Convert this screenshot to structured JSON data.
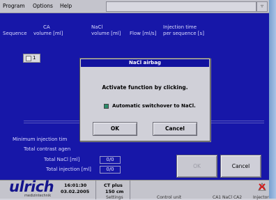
{
  "menu": {
    "items": [
      "Program",
      "Options",
      "Help"
    ]
  },
  "table": {
    "headers": {
      "sequence": "Sequence",
      "ca_top": "CA",
      "ca_bottom": "volume [ml]",
      "nacl_top": "NaCl",
      "nacl_bottom": "volume [ml]",
      "flow": "Flow [ml/s]",
      "inj_top": "Injection time",
      "inj_bottom": "per sequence [s]"
    },
    "first_sequence": "1"
  },
  "summary": {
    "min_injection_label": "Minimum injection tim",
    "total_contrast_label": "Total contrast agen",
    "total_nacl_label": "Total NaCl [ml]",
    "total_nacl_value": "0/0",
    "total_injection_label": "Total injection [ml]",
    "total_injection_value": "0/0"
  },
  "buttons": {
    "ok": "OK",
    "cancel": "Cancel"
  },
  "dialog": {
    "title": "NaCl airbag",
    "message": "Activate function by clicking.",
    "checkbox_label": "Automatic switchover to NaCl.",
    "checkbox_checked": true,
    "ok": "OK",
    "cancel": "Cancel"
  },
  "status": {
    "brand": "ulrich",
    "brand_sub": "medizintechnik",
    "time": "16:01:30",
    "date": "03.02.2005",
    "ct_line1": "CT plus",
    "ct_line2": "150 cm",
    "settings": "Settings",
    "control": "Control unit",
    "ca_list": "CA1  NaCl  CA2",
    "injector": "Injector"
  },
  "colors": {
    "panel": "#1717a8",
    "dialog_title": "#12129e",
    "check": "#2a8c6a",
    "brand": "#14148c"
  }
}
